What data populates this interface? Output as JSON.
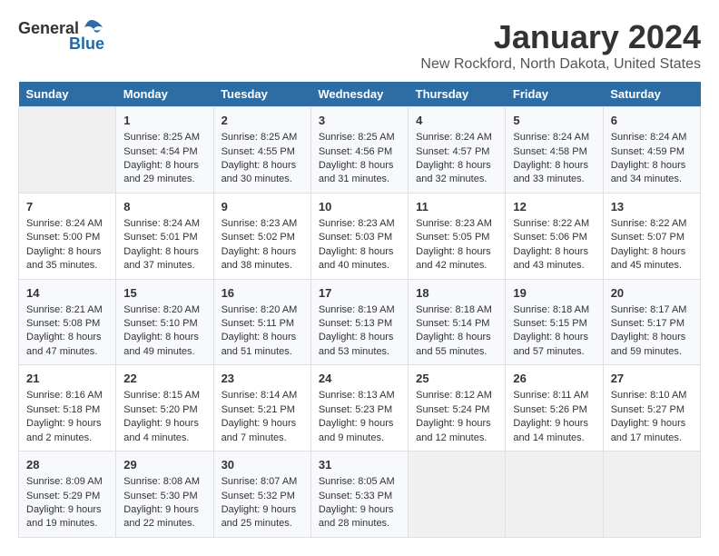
{
  "logo": {
    "general": "General",
    "blue": "Blue"
  },
  "title": "January 2024",
  "location": "New Rockford, North Dakota, United States",
  "days_of_week": [
    "Sunday",
    "Monday",
    "Tuesday",
    "Wednesday",
    "Thursday",
    "Friday",
    "Saturday"
  ],
  "weeks": [
    [
      {
        "day": "",
        "content": ""
      },
      {
        "day": "1",
        "content": "Sunrise: 8:25 AM\nSunset: 4:54 PM\nDaylight: 8 hours\nand 29 minutes."
      },
      {
        "day": "2",
        "content": "Sunrise: 8:25 AM\nSunset: 4:55 PM\nDaylight: 8 hours\nand 30 minutes."
      },
      {
        "day": "3",
        "content": "Sunrise: 8:25 AM\nSunset: 4:56 PM\nDaylight: 8 hours\nand 31 minutes."
      },
      {
        "day": "4",
        "content": "Sunrise: 8:24 AM\nSunset: 4:57 PM\nDaylight: 8 hours\nand 32 minutes."
      },
      {
        "day": "5",
        "content": "Sunrise: 8:24 AM\nSunset: 4:58 PM\nDaylight: 8 hours\nand 33 minutes."
      },
      {
        "day": "6",
        "content": "Sunrise: 8:24 AM\nSunset: 4:59 PM\nDaylight: 8 hours\nand 34 minutes."
      }
    ],
    [
      {
        "day": "7",
        "content": "Sunrise: 8:24 AM\nSunset: 5:00 PM\nDaylight: 8 hours\nand 35 minutes."
      },
      {
        "day": "8",
        "content": "Sunrise: 8:24 AM\nSunset: 5:01 PM\nDaylight: 8 hours\nand 37 minutes."
      },
      {
        "day": "9",
        "content": "Sunrise: 8:23 AM\nSunset: 5:02 PM\nDaylight: 8 hours\nand 38 minutes."
      },
      {
        "day": "10",
        "content": "Sunrise: 8:23 AM\nSunset: 5:03 PM\nDaylight: 8 hours\nand 40 minutes."
      },
      {
        "day": "11",
        "content": "Sunrise: 8:23 AM\nSunset: 5:05 PM\nDaylight: 8 hours\nand 42 minutes."
      },
      {
        "day": "12",
        "content": "Sunrise: 8:22 AM\nSunset: 5:06 PM\nDaylight: 8 hours\nand 43 minutes."
      },
      {
        "day": "13",
        "content": "Sunrise: 8:22 AM\nSunset: 5:07 PM\nDaylight: 8 hours\nand 45 minutes."
      }
    ],
    [
      {
        "day": "14",
        "content": "Sunrise: 8:21 AM\nSunset: 5:08 PM\nDaylight: 8 hours\nand 47 minutes."
      },
      {
        "day": "15",
        "content": "Sunrise: 8:20 AM\nSunset: 5:10 PM\nDaylight: 8 hours\nand 49 minutes."
      },
      {
        "day": "16",
        "content": "Sunrise: 8:20 AM\nSunset: 5:11 PM\nDaylight: 8 hours\nand 51 minutes."
      },
      {
        "day": "17",
        "content": "Sunrise: 8:19 AM\nSunset: 5:13 PM\nDaylight: 8 hours\nand 53 minutes."
      },
      {
        "day": "18",
        "content": "Sunrise: 8:18 AM\nSunset: 5:14 PM\nDaylight: 8 hours\nand 55 minutes."
      },
      {
        "day": "19",
        "content": "Sunrise: 8:18 AM\nSunset: 5:15 PM\nDaylight: 8 hours\nand 57 minutes."
      },
      {
        "day": "20",
        "content": "Sunrise: 8:17 AM\nSunset: 5:17 PM\nDaylight: 8 hours\nand 59 minutes."
      }
    ],
    [
      {
        "day": "21",
        "content": "Sunrise: 8:16 AM\nSunset: 5:18 PM\nDaylight: 9 hours\nand 2 minutes."
      },
      {
        "day": "22",
        "content": "Sunrise: 8:15 AM\nSunset: 5:20 PM\nDaylight: 9 hours\nand 4 minutes."
      },
      {
        "day": "23",
        "content": "Sunrise: 8:14 AM\nSunset: 5:21 PM\nDaylight: 9 hours\nand 7 minutes."
      },
      {
        "day": "24",
        "content": "Sunrise: 8:13 AM\nSunset: 5:23 PM\nDaylight: 9 hours\nand 9 minutes."
      },
      {
        "day": "25",
        "content": "Sunrise: 8:12 AM\nSunset: 5:24 PM\nDaylight: 9 hours\nand 12 minutes."
      },
      {
        "day": "26",
        "content": "Sunrise: 8:11 AM\nSunset: 5:26 PM\nDaylight: 9 hours\nand 14 minutes."
      },
      {
        "day": "27",
        "content": "Sunrise: 8:10 AM\nSunset: 5:27 PM\nDaylight: 9 hours\nand 17 minutes."
      }
    ],
    [
      {
        "day": "28",
        "content": "Sunrise: 8:09 AM\nSunset: 5:29 PM\nDaylight: 9 hours\nand 19 minutes."
      },
      {
        "day": "29",
        "content": "Sunrise: 8:08 AM\nSunset: 5:30 PM\nDaylight: 9 hours\nand 22 minutes."
      },
      {
        "day": "30",
        "content": "Sunrise: 8:07 AM\nSunset: 5:32 PM\nDaylight: 9 hours\nand 25 minutes."
      },
      {
        "day": "31",
        "content": "Sunrise: 8:05 AM\nSunset: 5:33 PM\nDaylight: 9 hours\nand 28 minutes."
      },
      {
        "day": "",
        "content": ""
      },
      {
        "day": "",
        "content": ""
      },
      {
        "day": "",
        "content": ""
      }
    ]
  ]
}
